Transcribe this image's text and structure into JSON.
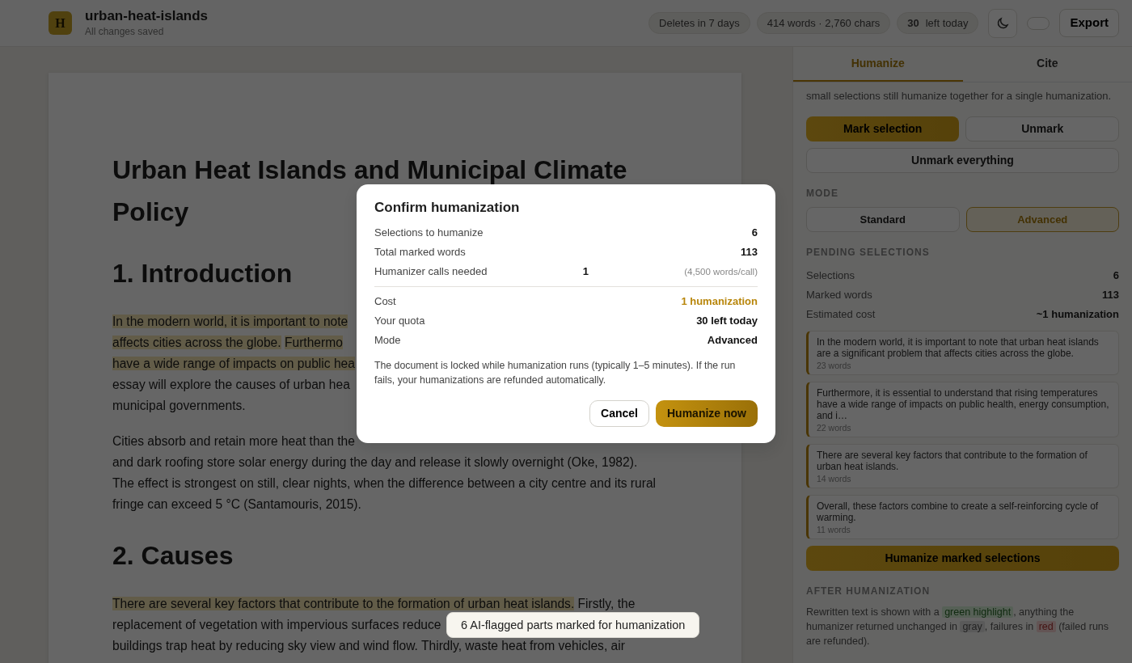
{
  "header": {
    "logo_letter": "H",
    "doc_title": "urban-heat-islands",
    "save_status": "All changes saved",
    "chips": [
      {
        "kind": "plain",
        "text": "Deletes in 7 days"
      },
      {
        "kind": "plain",
        "text": "414 words · 2,760 chars"
      },
      {
        "kind": "count",
        "value": "30",
        "text": "left today"
      }
    ],
    "toggle": {
      "on": false
    },
    "export_label": "Export"
  },
  "document": {
    "title_lines": [
      "Urban Heat Islands and Municipal Climate",
      "Policy"
    ],
    "blocks": [
      {
        "kind": "heading",
        "text": "1. Introduction"
      },
      {
        "kind": "paragraph",
        "lines": [
          [
            {
              "text": "In the modern world, it is important to note",
              "highlighted": true
            }
          ],
          [
            {
              "text": "affects cities across the globe.",
              "highlighted": true
            },
            {
              "text": "Furthermo",
              "highlighted": true
            }
          ],
          [
            {
              "text": "have a wide range of impacts on public hea",
              "highlighted": true
            }
          ],
          [
            {
              "text": "essay will explore the causes of urban hea",
              "highlighted": false
            }
          ],
          [
            {
              "text": "municipal governments.",
              "highlighted": false
            }
          ]
        ]
      },
      {
        "kind": "paragraph",
        "lines": [
          [
            {
              "text": "Cities absorb and retain more heat than the",
              "highlighted": false
            }
          ],
          [
            {
              "text": "and dark roofing store solar energy during the day and release it slowly overnight (Oke, 1982).",
              "highlighted": false
            }
          ],
          [
            {
              "text": "The effect is strongest on still, clear nights, when the difference between a city centre and its rural",
              "highlighted": false
            }
          ],
          [
            {
              "text": "fringe can exceed 5 °C (Santamouris, 2015).",
              "highlighted": false
            }
          ]
        ]
      },
      {
        "kind": "heading",
        "text": "2. Causes"
      },
      {
        "kind": "paragraph",
        "lines": [
          [
            {
              "text": "There are several key factors that contribute to the formation of urban heat islands.",
              "highlighted": true
            },
            {
              "text": "Firstly, the",
              "highlighted": false
            }
          ],
          [
            {
              "text": "replacement of vegetation with impervious surfaces reduce",
              "highlighted": false
            }
          ],
          [
            {
              "text": "buildings trap heat by reducing sky view and wind flow.",
              "highlighted": false
            },
            {
              "text": "Thirdly, waste heat from vehicles, air",
              "highlighted": false
            }
          ]
        ]
      }
    ]
  },
  "sidebar": {
    "tabs": [
      {
        "label": "Humanize",
        "selected": true
      },
      {
        "label": "Cite",
        "selected": false
      }
    ],
    "intro": "small selections still humanize together for a single humanization.",
    "mark_button": "Mark selection",
    "unmark_button": "Unmark",
    "unmark_all_button": "Unmark everything",
    "mode_heading": "MODE",
    "modes": [
      {
        "label": "Standard",
        "selected": false
      },
      {
        "label": "Advanced",
        "selected": true
      }
    ],
    "pending_heading": "PENDING SELECTIONS",
    "stats": [
      {
        "label": "Selections",
        "value": "6"
      },
      {
        "label": "Marked words",
        "value": "113"
      },
      {
        "label": "Estimated cost",
        "value": "~1 humanization"
      }
    ],
    "selections": [
      {
        "text": "In the modern world, it is important to note that urban heat islands are a significant problem that affects cities across the globe.",
        "words": "23 words"
      },
      {
        "text": "Furthermore, it is essential to understand that rising temperatures have a wide range of impacts on public health, energy consumption, and i…",
        "words": "22 words"
      },
      {
        "text": "There are several key factors that contribute to the formation of urban heat islands.",
        "words": "14 words"
      },
      {
        "text": "Overall, these factors combine to create a self-reinforcing cycle of warming.",
        "words": "11 words"
      }
    ],
    "humanize_button": "Humanize marked selections",
    "after_heading": "AFTER HUMANIZATION",
    "legend": [
      {
        "kind": "text",
        "text": "Rewritten text is shown with a "
      },
      {
        "kind": "green",
        "text": "green highlight"
      },
      {
        "kind": "text",
        "text": ", anything the humanizer returned unchanged in "
      },
      {
        "kind": "gray",
        "text": "gray"
      },
      {
        "kind": "text",
        "text": ", failures in "
      },
      {
        "kind": "red",
        "text": "red"
      },
      {
        "kind": "text",
        "text": " (failed runs are refunded)."
      }
    ]
  },
  "modal": {
    "title": "Confirm humanization",
    "rows": [
      {
        "label": "Selections to humanize",
        "value": "6"
      },
      {
        "label": "Total marked words",
        "value": "113"
      },
      {
        "label": "Humanizer calls needed",
        "value": "1",
        "note": "(4,500 words/call)"
      }
    ],
    "cost_rows": [
      {
        "label": "Cost",
        "value": "1 humanization",
        "accent": true
      },
      {
        "label": "Your quota",
        "value": "30 left today",
        "accent": false
      },
      {
        "label": "Mode",
        "value": "Advanced",
        "accent": false
      }
    ],
    "notice": "The document is locked while humanization runs (typically 1–5 minutes). If the run fails, your humanizations are refunded automatically.",
    "cancel_label": "Cancel",
    "confirm_label": "Humanize now"
  },
  "toast": "6 AI-flagged parts marked for humanization"
}
